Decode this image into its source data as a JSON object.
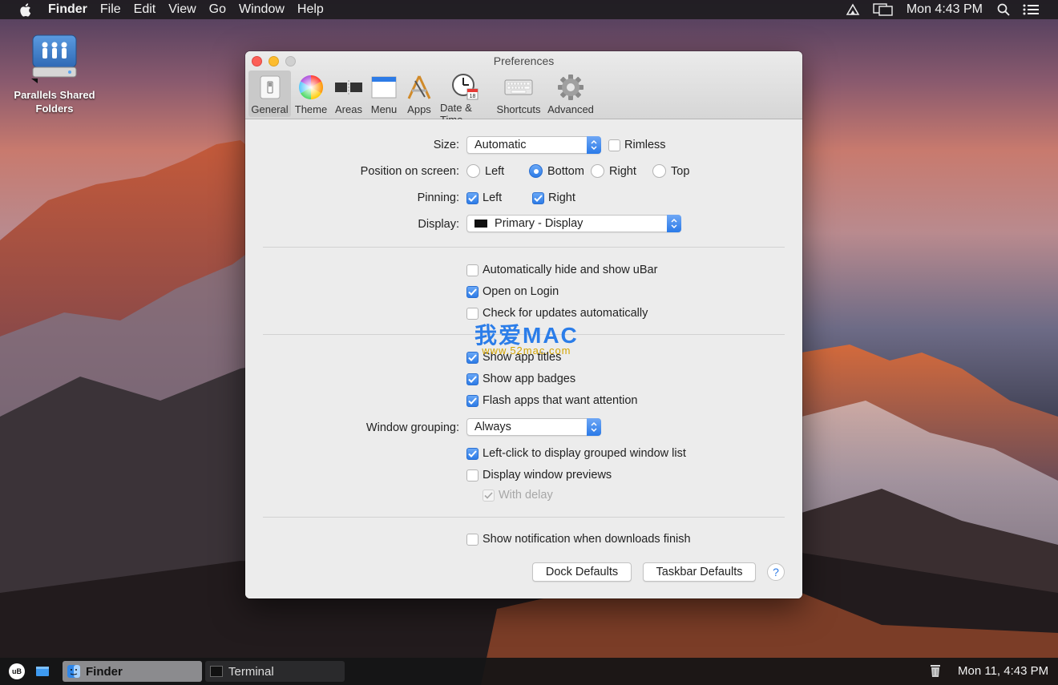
{
  "menubar": {
    "app_name": "Finder",
    "menus": [
      "File",
      "Edit",
      "View",
      "Go",
      "Window",
      "Help"
    ],
    "clock": "Mon 4:43 PM",
    "icons": [
      "apple-logo",
      "airplay-icon",
      "display-mirroring-icon",
      "spotlight-search-icon",
      "notification-center-icon"
    ]
  },
  "desktop": {
    "icon_label": "Parallels Shared Folders"
  },
  "window": {
    "title": "Preferences",
    "tabs": [
      {
        "label": "General",
        "icon": "switch-icon",
        "active": true
      },
      {
        "label": "Theme",
        "icon": "color-wheel-icon",
        "active": false
      },
      {
        "label": "Areas",
        "icon": "areas-icon",
        "active": false
      },
      {
        "label": "Menu",
        "icon": "menu-bar-icon",
        "active": false
      },
      {
        "label": "Apps",
        "icon": "apps-icon",
        "active": false
      },
      {
        "label": "Date & Time",
        "icon": "clock-calendar-icon",
        "active": false
      },
      {
        "label": "Shortcuts",
        "icon": "keyboard-icon",
        "active": false
      },
      {
        "label": "Advanced",
        "icon": "gear-icon",
        "active": false
      }
    ]
  },
  "general": {
    "size_label": "Size:",
    "size_value": "Automatic",
    "rimless_label": "Rimless",
    "rimless_checked": false,
    "position_label": "Position on screen:",
    "position_options": [
      {
        "label": "Left",
        "selected": false
      },
      {
        "label": "Bottom",
        "selected": true
      },
      {
        "label": "Right",
        "selected": false
      },
      {
        "label": "Top",
        "selected": false
      }
    ],
    "pinning_label": "Pinning:",
    "pin_left_label": "Left",
    "pin_left_checked": true,
    "pin_right_label": "Right",
    "pin_right_checked": true,
    "display_label": "Display:",
    "display_value": "Primary - Display",
    "auto_hide_label": "Automatically hide and show uBar",
    "auto_hide_checked": false,
    "open_login_label": "Open on Login",
    "open_login_checked": true,
    "check_updates_label": "Check for updates automatically",
    "check_updates_checked": false,
    "show_titles_label": "Show app titles",
    "show_titles_checked": true,
    "show_badges_label": "Show app badges",
    "show_badges_checked": true,
    "flash_apps_label": "Flash apps that want attention",
    "flash_apps_checked": true,
    "grouping_label": "Window grouping:",
    "grouping_value": "Always",
    "left_click_label": "Left-click to display grouped window list",
    "left_click_checked": true,
    "previews_label": "Display window previews",
    "previews_checked": false,
    "delay_label": "With delay",
    "delay_checked": true,
    "delay_enabled": false,
    "downloads_label": "Show notification when downloads finish",
    "downloads_checked": false,
    "dock_defaults_label": "Dock Defaults",
    "taskbar_defaults_label": "Taskbar Defaults",
    "help_label": "?"
  },
  "watermark": {
    "title": "我爱MAC",
    "url": "www.52mac.com"
  },
  "taskbar": {
    "ubar_logo": "uB",
    "tasks": [
      {
        "label": "Finder",
        "active": true
      },
      {
        "label": "Terminal",
        "active": false
      }
    ],
    "clock": "Mon 11, 4:43 PM"
  },
  "colors": {
    "accent": "#2d7be6",
    "menubar": "#1e1c20",
    "window_bg": "#ececec"
  }
}
